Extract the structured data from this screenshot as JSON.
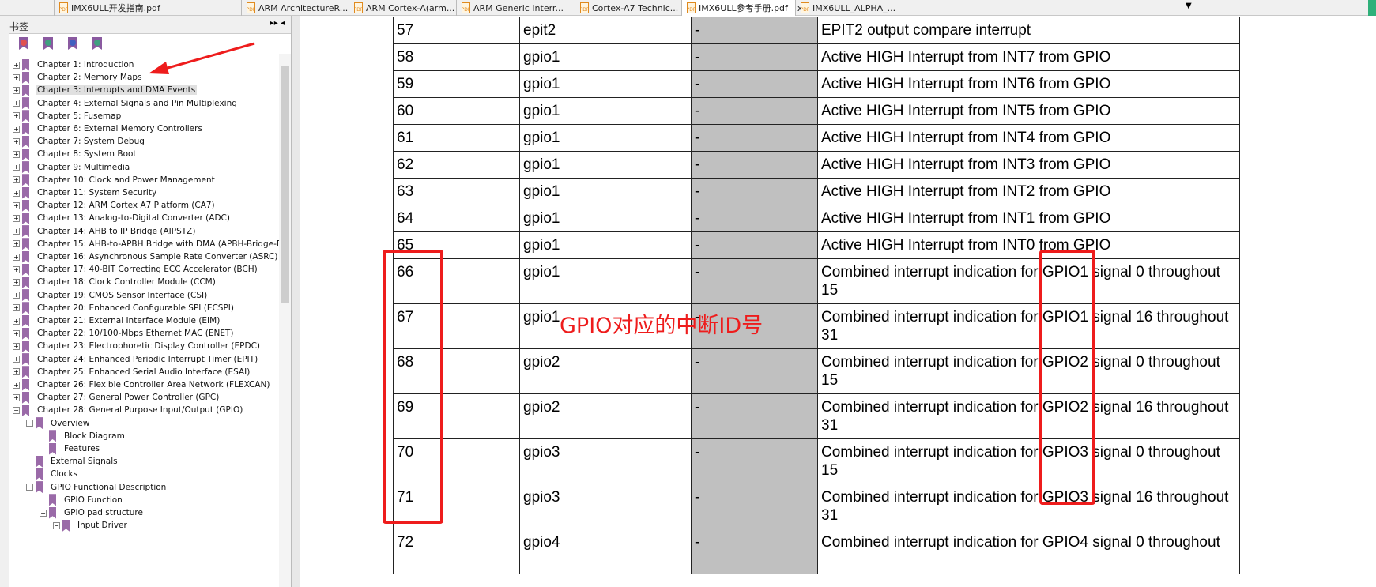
{
  "tabs": [
    {
      "label": "IMX6ULL开发指南.pdf",
      "active": false
    },
    {
      "label": "ARM ArchitectureR...",
      "active": false
    },
    {
      "label": "ARM Cortex-A(arm...",
      "active": false
    },
    {
      "label": "ARM Generic Interr...",
      "active": false
    },
    {
      "label": "Cortex-A7 Technic...",
      "active": false
    },
    {
      "label": "IMX6ULL参考手册.pdf",
      "active": true
    },
    {
      "label": "IMX6ULL_ALPHA_...",
      "active": false
    }
  ],
  "tab_close": "x",
  "tab_menu": "▼",
  "sidebar": {
    "title": "书签",
    "controls": "▸▸ ◂",
    "tools": [
      {
        "icon": "delete-bookmark-icon",
        "color": "#e05050"
      },
      {
        "icon": "add-bookmark-icon",
        "color": "#40a080"
      },
      {
        "icon": "goto-bookmark-icon",
        "color": "#4060c0"
      },
      {
        "icon": "expand-bookmark-icon",
        "color": "#40a080"
      }
    ],
    "items": [
      {
        "label": "Chapter 1: Introduction",
        "level": 0,
        "exp": "+"
      },
      {
        "label": "Chapter 2: Memory Maps",
        "level": 0,
        "exp": "+"
      },
      {
        "label": "Chapter 3: Interrupts and DMA Events",
        "level": 0,
        "exp": "+",
        "selected": true
      },
      {
        "label": "Chapter 4: External Signals and Pin Multiplexing",
        "level": 0,
        "exp": "+"
      },
      {
        "label": "Chapter 5:  Fusemap",
        "level": 0,
        "exp": "+"
      },
      {
        "label": "Chapter 6: External Memory Controllers",
        "level": 0,
        "exp": "+"
      },
      {
        "label": "Chapter 7: System Debug",
        "level": 0,
        "exp": "+"
      },
      {
        "label": "Chapter 8: System Boot",
        "level": 0,
        "exp": "+"
      },
      {
        "label": "Chapter 9: Multimedia",
        "level": 0,
        "exp": "+"
      },
      {
        "label": "Chapter 10: Clock and Power Management",
        "level": 0,
        "exp": "+"
      },
      {
        "label": "Chapter 11: System Security",
        "level": 0,
        "exp": "+"
      },
      {
        "label": "Chapter 12: ARM Cortex A7 Platform (CA7)",
        "level": 0,
        "exp": "+"
      },
      {
        "label": "Chapter 13: Analog-to-Digital Converter (ADC)",
        "level": 0,
        "exp": "+"
      },
      {
        "label": "Chapter 14: AHB to IP Bridge (AIPSTZ)",
        "level": 0,
        "exp": "+"
      },
      {
        "label": "Chapter 15: AHB-to-APBH Bridge with DMA (APBH-Bridge-DMA)",
        "level": 0,
        "exp": "+"
      },
      {
        "label": "Chapter 16: Asynchronous Sample Rate Converter (ASRC)",
        "level": 0,
        "exp": "+"
      },
      {
        "label": "Chapter 17: 40-BIT            Correcting ECC Accelerator (BCH)",
        "level": 0,
        "exp": "+"
      },
      {
        "label": "Chapter 18: Clock Controller Module (CCM)",
        "level": 0,
        "exp": "+"
      },
      {
        "label": "Chapter 19: CMOS Sensor Interface (CSI)",
        "level": 0,
        "exp": "+"
      },
      {
        "label": "Chapter 20: Enhanced Configurable SPI (ECSPI)",
        "level": 0,
        "exp": "+"
      },
      {
        "label": "Chapter 21: External Interface Module (EIM)",
        "level": 0,
        "exp": "+"
      },
      {
        "label": "Chapter 22: 10/100-Mbps Ethernet MAC (ENET)",
        "level": 0,
        "exp": "+"
      },
      {
        "label": "Chapter 23: Electrophoretic Display Controller (EPDC)",
        "level": 0,
        "exp": "+"
      },
      {
        "label": "Chapter 24: Enhanced Periodic Interrupt Timer (EPIT)",
        "level": 0,
        "exp": "+"
      },
      {
        "label": "Chapter 25: Enhanced Serial Audio Interface (ESAI)",
        "level": 0,
        "exp": "+"
      },
      {
        "label": "Chapter 26: Flexible Controller Area Network (FLEXCAN)",
        "level": 0,
        "exp": "+"
      },
      {
        "label": "Chapter 27: General Power Controller (GPC)",
        "level": 0,
        "exp": "+"
      },
      {
        "label": "Chapter 28: General Purpose Input/Output (GPIO)",
        "level": 0,
        "exp": "−"
      },
      {
        "label": "Overview",
        "level": 1,
        "exp": "−"
      },
      {
        "label": "Block Diagram",
        "level": 2,
        "exp": ""
      },
      {
        "label": "Features",
        "level": 2,
        "exp": ""
      },
      {
        "label": "External Signals",
        "level": 1,
        "exp": ""
      },
      {
        "label": "Clocks",
        "level": 1,
        "exp": ""
      },
      {
        "label": "GPIO Functional Description",
        "level": 1,
        "exp": "−"
      },
      {
        "label": "GPIO Function",
        "level": 2,
        "exp": ""
      },
      {
        "label": "GPIO pad structure",
        "level": 2,
        "exp": "−"
      },
      {
        "label": "Input Driver",
        "level": 3,
        "exp": "−"
      }
    ]
  },
  "table": {
    "rows": [
      [
        "57",
        "epit2",
        "-",
        "EPIT2 output compare interrupt"
      ],
      [
        "58",
        "gpio1",
        "-",
        "Active HIGH Interrupt from INT7 from GPIO"
      ],
      [
        "59",
        "gpio1",
        "-",
        "Active HIGH Interrupt from INT6 from GPIO"
      ],
      [
        "60",
        "gpio1",
        "-",
        "Active HIGH Interrupt from INT5 from GPIO"
      ],
      [
        "61",
        "gpio1",
        "-",
        "Active HIGH Interrupt from INT4 from GPIO"
      ],
      [
        "62",
        "gpio1",
        "-",
        "Active HIGH Interrupt from INT3 from GPIO"
      ],
      [
        "63",
        "gpio1",
        "-",
        "Active HIGH Interrupt from INT2 from GPIO"
      ],
      [
        "64",
        "gpio1",
        "-",
        "Active HIGH Interrupt from INT1 from GPIO"
      ],
      [
        "65",
        "gpio1",
        "-",
        "Active HIGH Interrupt from INT0 from GPIO"
      ],
      [
        "66",
        "gpio1",
        "-",
        "Combined interrupt indication for GPIO1 signal 0 throughout 15"
      ],
      [
        "67",
        "gpio1",
        "-",
        "Combined interrupt indication for GPIO1 signal 16 throughout 31"
      ],
      [
        "68",
        "gpio2",
        "-",
        "Combined interrupt indication for GPIO2 signal 0 throughout 15"
      ],
      [
        "69",
        "gpio2",
        "-",
        "Combined interrupt indication for GPIO2 signal 16 throughout 31"
      ],
      [
        "70",
        "gpio3",
        "-",
        "Combined interrupt indication for GPIO3 signal 0 throughout 15"
      ],
      [
        "71",
        "gpio3",
        "-",
        "Combined interrupt indication for GPIO3 signal 16 throughout 31"
      ],
      [
        "72",
        "gpio4",
        "-",
        "Combined interrupt indication for GPIO4 signal 0 throughout"
      ]
    ]
  },
  "annotation": {
    "text": "GPIO对应的中断ID号",
    "color": "#ee1c1c"
  }
}
